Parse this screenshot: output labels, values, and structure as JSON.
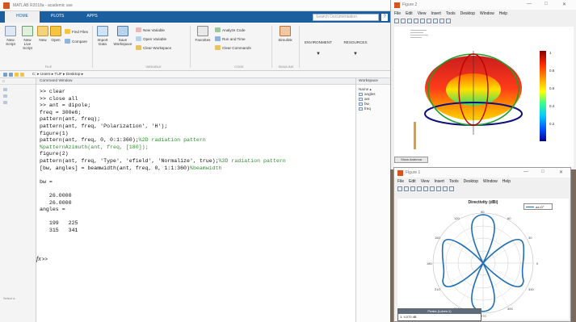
{
  "main_window": {
    "title": "MATLAB R2018a - academic use",
    "tabs": [
      {
        "label": "HOME"
      },
      {
        "label": "PLOTS"
      },
      {
        "label": "APPS"
      }
    ],
    "search_placeholder": "Search Documentation",
    "ribbon": {
      "new_script": "New Script",
      "new_live_script": "New Live Script",
      "new": "New",
      "open": "Open",
      "find_files": "Find Files",
      "compare": "Compare",
      "import_data": "Import Data",
      "save_workspace": "Save Workspace",
      "new_variable": "New Variable",
      "open_variable": "Open Variable",
      "clear_workspace": "Clear Workspace",
      "favorites": "Favorites",
      "analyze_code": "Analyze Code",
      "run_and_time": "Run and Time",
      "clear_commands": "Clear Commands",
      "simulink": "Simulink",
      "environment": "ENVIRONMENT",
      "resources": "RESOURCES",
      "group_file": "FILE",
      "group_variable": "VARIABLE",
      "group_code": "CODE",
      "group_simulink": "SIMULINK"
    },
    "address_path": "C: ▸ Users ▸ TUF ▸ Desktop ▸",
    "command_window_title": "Command Window",
    "command_lines": [
      {
        "code": ">> clear",
        "comment": ""
      },
      {
        "code": ">> close all",
        "comment": ""
      },
      {
        "code": ">> ant = dipole;",
        "comment": ""
      },
      {
        "code": "freq = 300e6;",
        "comment": ""
      },
      {
        "code": "pattern(ant, freq);",
        "comment": ""
      },
      {
        "code": "pattern(ant, freq, 'Polarization', 'H');",
        "comment": ""
      },
      {
        "code": "figure(1)",
        "comment": ""
      },
      {
        "code": "pattern(ant, freq, 0, 0:1:360);",
        "comment": "%2D radiation pattern"
      },
      {
        "code": "",
        "comment": "%patternAzimuth(ant, freq, [180]);"
      },
      {
        "code": "figure(2)",
        "comment": ""
      },
      {
        "code": "pattern(ant, freq, 'Type', 'efield', 'Normalize', true);",
        "comment": "%3D radiation pattern"
      },
      {
        "code": "[bw, angles] = beamwidth(ant, freq, 0, 1:1:360)",
        "comment": "%beamwidth"
      },
      {
        "code": "",
        "comment": ""
      },
      {
        "code": "bw =",
        "comment": ""
      },
      {
        "code": "",
        "comment": ""
      },
      {
        "code": "   26.0000",
        "comment": ""
      },
      {
        "code": "   26.0000",
        "comment": ""
      },
      {
        "code": "angles =",
        "comment": ""
      },
      {
        "code": "",
        "comment": ""
      },
      {
        "code": "   199   225",
        "comment": ""
      },
      {
        "code": "   315   341",
        "comment": ""
      }
    ],
    "prompt_fx": "fx",
    "prompt_arrows": ">>",
    "workspace": {
      "title": "Workspace",
      "name_col": "Name ▴",
      "vars": [
        "angles",
        "ant",
        "bw",
        "freq"
      ]
    },
    "folder_pane": {
      "header": "Current Folder",
      "select_label": "Select a"
    }
  },
  "figure2": {
    "title": "Figure 2",
    "menu": [
      "File",
      "Edit",
      "View",
      "Insert",
      "Tools",
      "Desktop",
      "Window",
      "Help"
    ],
    "colorbar_ticks": [
      "1",
      "0.8",
      "0.6",
      "0.4",
      "0.2"
    ],
    "show_antenna": "Show Antenna"
  },
  "figure1": {
    "title": "Figure 1",
    "menu": [
      "File",
      "Edit",
      "View",
      "Insert",
      "Tools",
      "Desktop",
      "Window",
      "Help"
    ],
    "plot_title": "Directivity (dBi)",
    "legend_label": "az=0°",
    "angle_labels": [
      "90",
      "120",
      "60",
      "150",
      "30",
      "180",
      "0",
      "210",
      "330",
      "240",
      "300",
      "270"
    ],
    "datatip_header": "Peaks (Lobes:1)",
    "datatip_value": "1: 4.070 dB"
  },
  "colors": {
    "matlab_blue": "#1c5f9e",
    "comment_green": "#2f8f2f",
    "polar_line": "#1f6fb4"
  }
}
